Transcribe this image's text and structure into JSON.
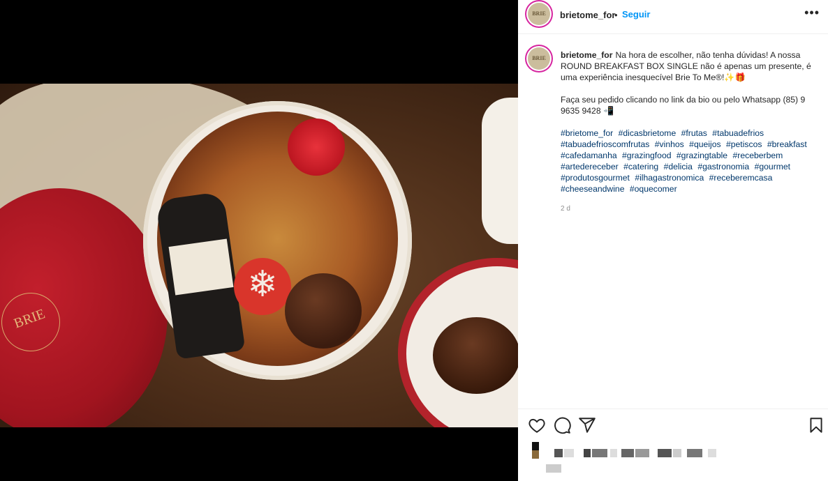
{
  "post": {
    "username": "brietome_for",
    "follow_label": "Seguir",
    "avatar_text": "BRIE",
    "more_icon": "more-options-icon",
    "caption_lines": [
      "Na hora de escolher, não tenha dúvidas! A nossa ROUND BREAKFAST BOX SINGLE não é apenas um presente, é uma experiência inesquecível Brie To Me®!✨🎁",
      "Faça seu pedido clicando no link da bio ou pelo Whatsapp (85) 9 9635 9428 📲"
    ],
    "hashtags": [
      "#brietome_for",
      "#dicasbrietome",
      "#frutas",
      "#tabuadefrios",
      "#tabuadefrioscomfrutas",
      "#vinhos",
      "#queijos",
      "#petiscos",
      "#breakfast",
      "#cafedamanha",
      "#grazingfood",
      "#grazingtable",
      "#receberbem",
      "#artedereceber",
      "#catering",
      "#delicia",
      "#gastronomia",
      "#gourmet",
      "#produtosgourmet",
      "#ilhagastronomica",
      "#receberemcasa",
      "#cheeseandwine",
      "#oquecomer"
    ],
    "time_ago": "2 d",
    "photo_box_logo": "BRIE",
    "accent_color": "#0095f6"
  }
}
